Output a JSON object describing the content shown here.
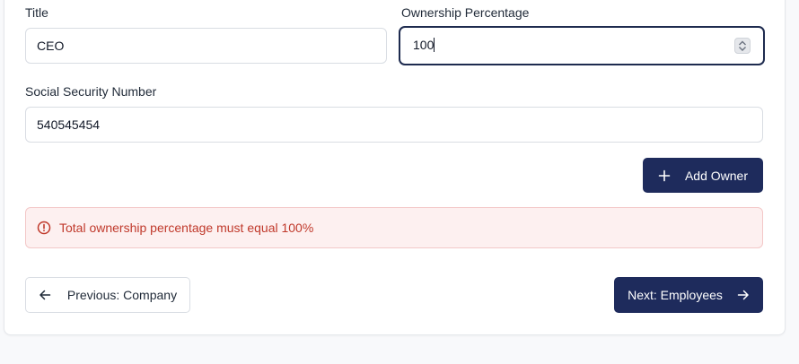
{
  "form": {
    "title_label": "Title",
    "title_value": "CEO",
    "ownership_label": "Ownership Percentage",
    "ownership_value": "100",
    "ssn_label": "Social Security Number",
    "ssn_value": "540545454"
  },
  "actions": {
    "add_owner_label": "Add Owner",
    "previous_label": "Previous: Company",
    "next_label": "Next: Employees"
  },
  "alert": {
    "message": "Total ownership percentage must equal 100%"
  },
  "colors": {
    "primary": "#1e2b5c",
    "error_text": "#c0392b",
    "error_bg": "#fdf0f0",
    "focus_border": "#1e2b4f"
  },
  "icons": {
    "add": "plus-icon",
    "previous": "arrow-left-icon",
    "next": "arrow-right-icon",
    "alert": "alert-circle-icon",
    "spinner": "number-spinner-icon"
  }
}
